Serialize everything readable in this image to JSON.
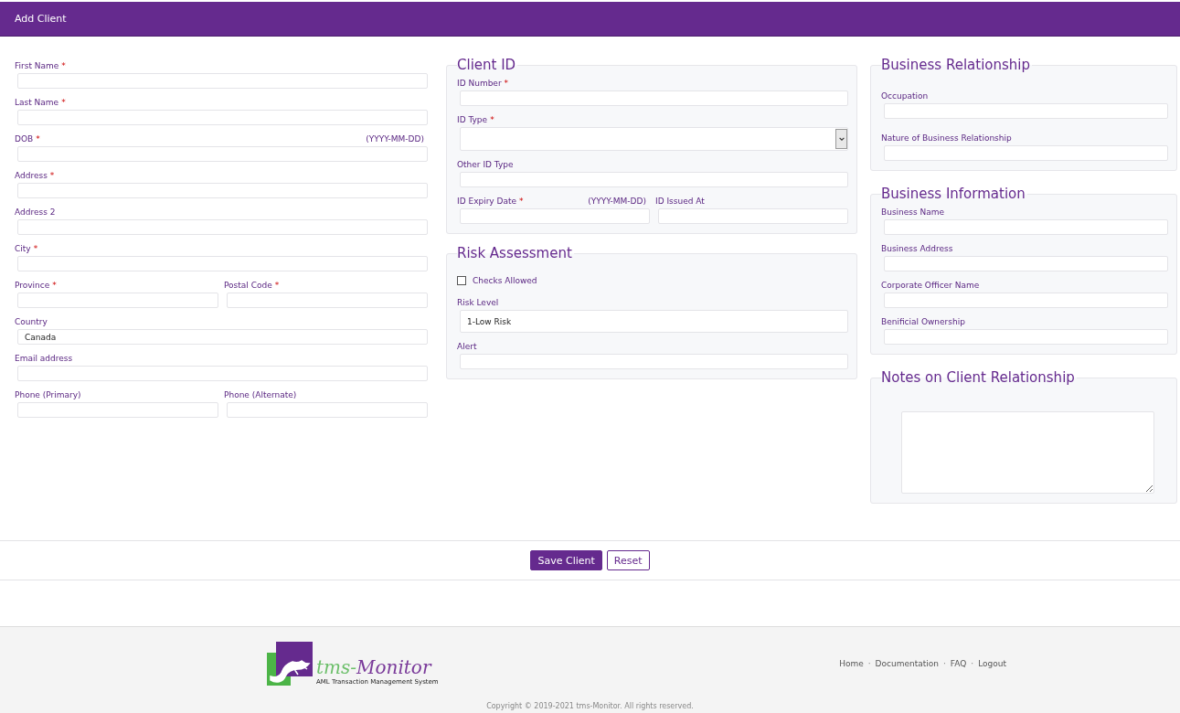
{
  "header": {
    "title": "Add Client"
  },
  "personal_details": {
    "rows": [
      [
        {
          "kind": "text",
          "label": "First Name",
          "required_mark": "*"
        }
      ],
      [
        {
          "kind": "text",
          "label": "Last Name",
          "required_mark": "*"
        }
      ],
      [
        {
          "kind": "text",
          "label": "DOB",
          "required_mark": "*",
          "hint": "(YYYY-MM-DD)"
        }
      ],
      [
        {
          "kind": "text",
          "label": "Address",
          "required_mark": "*"
        }
      ],
      [
        {
          "kind": "text",
          "label": "Address 2"
        }
      ],
      [
        {
          "kind": "text",
          "label": "City",
          "required_mark": "*"
        }
      ],
      [
        {
          "kind": "text",
          "label": "Province",
          "required_mark": "*"
        },
        {
          "kind": "text",
          "label": "Postal Code",
          "required_mark": "*"
        }
      ],
      [
        {
          "kind": "text",
          "label": "Country",
          "value": "Canada"
        }
      ],
      [
        {
          "kind": "text",
          "label": "Email address"
        }
      ],
      [
        {
          "kind": "text",
          "label": "Phone (Primary)"
        },
        {
          "kind": "text",
          "label": "Phone (Alternate)"
        }
      ]
    ]
  },
  "middle_sections": [
    {
      "title": "Client ID",
      "rows": [
        [
          {
            "kind": "text",
            "label": "ID Number",
            "required_mark": "*"
          }
        ],
        [
          {
            "kind": "select",
            "label": "ID Type",
            "required_mark": "*"
          }
        ],
        [
          {
            "kind": "text",
            "label": "Other ID Type"
          }
        ],
        [
          {
            "kind": "text",
            "label": "ID Expiry Date",
            "required_mark": "*",
            "hint": "(YYYY-MM-DD)"
          },
          {
            "kind": "text",
            "label": "ID Issued At"
          }
        ]
      ]
    },
    {
      "title": "Risk Assessment",
      "rows": [
        [
          {
            "kind": "checkbox",
            "label": "Checks Allowed",
            "checked": false
          }
        ],
        [
          {
            "kind": "tall",
            "label": "Risk Level",
            "value": "1-Low Risk"
          }
        ],
        [
          {
            "kind": "text",
            "label": "Alert"
          }
        ]
      ]
    }
  ],
  "right_sections": [
    {
      "title": "Business Relationship",
      "rows": [
        [
          {
            "kind": "text",
            "label": "Occupation"
          }
        ],
        [
          {
            "kind": "text",
            "label": "Nature of Business Relationship"
          }
        ]
      ]
    },
    {
      "title": "Business Information",
      "rows": [
        [
          {
            "kind": "text",
            "label": "Business Name"
          }
        ],
        [
          {
            "kind": "text",
            "label": "Business Address"
          }
        ],
        [
          {
            "kind": "text",
            "label": "Corporate Officer Name"
          }
        ],
        [
          {
            "kind": "text",
            "label": "Benificial Ownership"
          }
        ]
      ]
    },
    {
      "title": "Notes on Client Relationship",
      "rows": [
        [
          {
            "kind": "textarea"
          }
        ]
      ]
    }
  ],
  "actions": {
    "buttons": [
      {
        "label": "Save Client",
        "kind": "primary"
      },
      {
        "label": "Reset",
        "kind": "outline"
      }
    ]
  },
  "footer": {
    "brand_parts": [
      {
        "text": "tms-",
        "color": "#6cbf6a"
      },
      {
        "text": "Monitor",
        "color": "#7a3a9a"
      }
    ],
    "tagline": "AML Transaction Management System",
    "separator": "·",
    "links": [
      "Home",
      "Documentation",
      "FAQ",
      "Logout"
    ],
    "copyright": "Copyright © 2019-2021  tms-Monitor.   All rights reserved."
  }
}
